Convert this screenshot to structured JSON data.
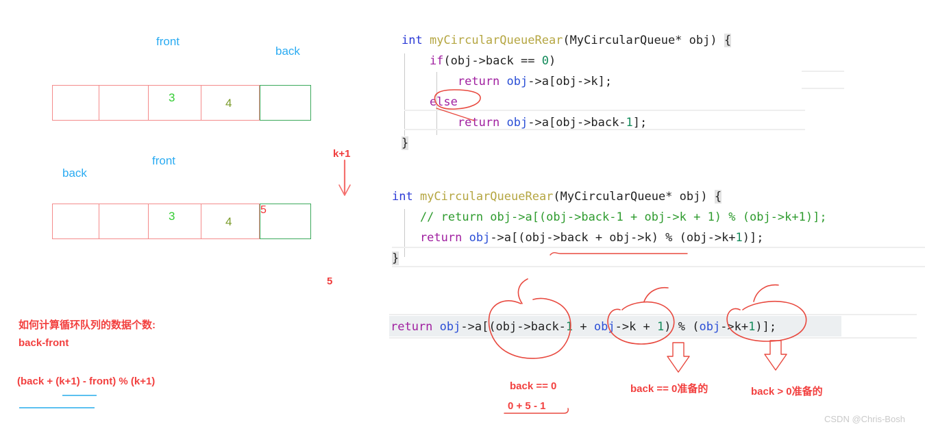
{
  "diagram": {
    "row1": {
      "front_label": "front",
      "back_label": "back",
      "cells": [
        "",
        "",
        "3",
        "4"
      ],
      "green_cell": ""
    },
    "row2": {
      "front_label": "front",
      "back_label": "back",
      "cells": [
        "",
        "",
        "3",
        "4"
      ],
      "green_cell": "5"
    },
    "middle": {
      "kplus1": "k+1",
      "five": "5"
    }
  },
  "notes": {
    "title": "如何计算循环队列的数据个数:",
    "line2": "back-front",
    "formula": "(back + (k+1) - front) % (k+1)"
  },
  "code_block_1": {
    "line1": {
      "t1": "int",
      "t2": " myCircularQueueRear",
      "t3": "(MyCircularQueue* obj) ",
      "t4": "{"
    },
    "line2": {
      "t1": "    if",
      "t2": "(obj->back == ",
      "t3": "0",
      "t4": ")"
    },
    "line3": {
      "t1": "        return",
      "t2": " obj",
      "t3": "->a[obj->k];"
    },
    "line4": {
      "t1": "    else"
    },
    "line5": {
      "t1": "        return",
      "t2": " obj",
      "t3": "->a[obj->back-",
      "t4": "1",
      "t5": "];"
    },
    "line6": {
      "t1": "}"
    }
  },
  "code_block_2": {
    "line1": {
      "t1": "int",
      "t2": " myCircularQueueRear",
      "t3": "(MyCircularQueue* obj) ",
      "t4": "{"
    },
    "line2": {
      "t1": "    // return obj->a[(obj->back-1 + obj->k + 1) % (obj->k+1)];"
    },
    "line3": {
      "t1": "    return",
      "t2": " obj",
      "t3": "->a[(obj->back + obj->k) % (obj->k+",
      "t4": "1",
      "t5": ")];"
    },
    "line4": {
      "t1": "}"
    }
  },
  "code_block_3": {
    "line": {
      "t1": "return",
      "t2": " obj",
      "t3": "->a[(obj",
      "t4": "->back-",
      "t5": "1",
      "t6": " + ",
      "t7": "obj",
      "t8": "->k + ",
      "t9": "1",
      "t10": ") % (",
      "t11": "obj",
      "t12": "->k+",
      "t13": "1",
      "t14": ")];"
    }
  },
  "annotations": {
    "a1": "back == 0",
    "a2": "0 + 5 - 1",
    "a3": "back == 0准备的",
    "a4": "back > 0准备的"
  },
  "watermark": "CSDN @Chris-Bosh",
  "colors": {
    "ink_red": "#e8493f",
    "label_blue": "#2aabf2",
    "cell_red": "#f48a8a",
    "cell_green": "#3aa85a",
    "note_red": "#f2403f"
  }
}
